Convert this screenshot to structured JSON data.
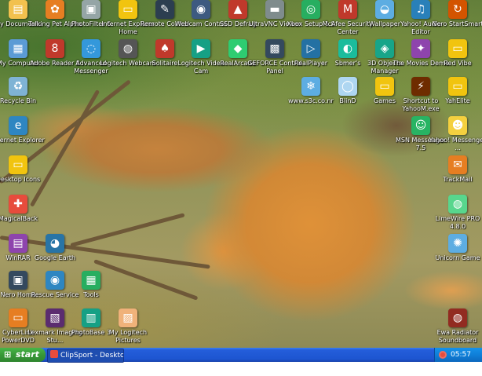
{
  "desktop": {
    "icons": [
      {
        "label": "My Documents",
        "icon": "folder-documents-icon",
        "color": "#f2c14e",
        "glyph": "▤"
      },
      {
        "label": "Talking Pet Alpha",
        "icon": "talking-pet-icon",
        "color": "#e67e22",
        "glyph": "✿"
      },
      {
        "label": "PhotoFilter 6",
        "icon": "photofilter-icon",
        "color": "#95a5a6",
        "glyph": "▣"
      },
      {
        "label": "Internet Explorer Home",
        "icon": "folder-icon",
        "color": "#f1c40f",
        "glyph": "▭"
      },
      {
        "label": "Remote Control",
        "icon": "remote-control-icon",
        "color": "#2c3e50",
        "glyph": "✎"
      },
      {
        "label": "Webcam Control",
        "icon": "webcam-icon",
        "color": "#3d5a80",
        "glyph": "◉"
      },
      {
        "label": "SSD Defrag",
        "icon": "defrag-icon",
        "color": "#c0392b",
        "glyph": "▲"
      },
      {
        "label": "UltraVNC Viewer",
        "icon": "vnc-viewer-icon",
        "color": "#7f8c8d",
        "glyph": "▬"
      },
      {
        "label": "Xbox Setup 1.0",
        "icon": "xbox-setup-icon",
        "color": "#27ae60",
        "glyph": "◎"
      },
      {
        "label": "McAfee Security Center",
        "icon": "mcafee-icon",
        "color": "#c0392b",
        "glyph": "M"
      },
      {
        "label": "Wallpaper",
        "icon": "wallpaper-icon",
        "color": "#5dade2",
        "glyph": "◒"
      },
      {
        "label": "Yahoo! Audio Editor",
        "icon": "audio-editor-icon",
        "color": "#2980b9",
        "glyph": "♫"
      },
      {
        "label": "Nero StartSmart",
        "icon": "nero-icon",
        "color": "#d35400",
        "glyph": "↻"
      },
      {
        "label": "My Computer",
        "icon": "my-computer-icon",
        "color": "#5b9bd5",
        "glyph": "▦"
      },
      {
        "label": "Adobe Reader 8",
        "icon": "adobe-reader-icon",
        "color": "#c0392b",
        "glyph": "8"
      },
      {
        "label": "Advanced Messenger",
        "icon": "messenger-icon",
        "color": "#3498db",
        "glyph": "◌"
      },
      {
        "label": "Logitech Webcam",
        "icon": "webcam-software-icon",
        "color": "#555555",
        "glyph": "◍"
      },
      {
        "label": "Solitaire",
        "icon": "solitaire-icon",
        "color": "#c0392b",
        "glyph": "♠"
      },
      {
        "label": "Logitech Video Cam",
        "icon": "video-cam-icon",
        "color": "#16a085",
        "glyph": "▶"
      },
      {
        "label": "RealArcade",
        "icon": "realarcade-icon",
        "color": "#2ecc71",
        "glyph": "◆"
      },
      {
        "label": "GEFORCE Control Panel",
        "icon": "control-panel-icon",
        "color": "#34495e",
        "glyph": "▩"
      },
      {
        "label": "RealPlayer",
        "icon": "realplayer-icon",
        "color": "#2471a3",
        "glyph": "▷"
      },
      {
        "label": "Sbmer's",
        "icon": "globe-icon",
        "color": "#1abc9c",
        "glyph": "◐"
      },
      {
        "label": "3D Objects Manager",
        "icon": "objects-manager-icon",
        "color": "#17a589",
        "glyph": "◈"
      },
      {
        "label": "The Movies Demo",
        "icon": "movies-demo-icon",
        "color": "#8e44ad",
        "glyph": "✦"
      },
      {
        "label": "Red Vibe",
        "icon": "folder-icon",
        "color": "#f1c40f",
        "glyph": "▭"
      },
      {
        "label": "Recycle Bin",
        "icon": "recycle-bin-icon",
        "color": "#7fb3d5",
        "glyph": "♻"
      },
      {
        "label": "www.s3c.co.nr",
        "icon": "snowflake-icon",
        "color": "#5dade2",
        "glyph": "❄"
      },
      {
        "label": "BlinD",
        "icon": "chat-bubble-icon",
        "color": "#aed6f1",
        "glyph": "◯"
      },
      {
        "label": "Games",
        "icon": "folder-icon",
        "color": "#f1c40f",
        "glyph": "▭"
      },
      {
        "label": "Shortcut to YahooM.exe",
        "icon": "shortcut-icon",
        "color": "#6e2c00",
        "glyph": "⚡"
      },
      {
        "label": "YahElite",
        "icon": "folder-icon",
        "color": "#f1c40f",
        "glyph": "▭"
      },
      {
        "label": "Internet Explorer",
        "icon": "internet-explorer-icon",
        "color": "#2e86c1",
        "glyph": "e"
      },
      {
        "label": "MSN Messenger 7.5",
        "icon": "msn-messenger-icon",
        "color": "#28b463",
        "glyph": "☺"
      },
      {
        "label": "Yahoo! Messenger ...",
        "icon": "yahoo-messenger-icon",
        "color": "#f4d03f",
        "glyph": "☻"
      },
      {
        "label": "Desktop Icons",
        "icon": "folder-icon",
        "color": "#f1c40f",
        "glyph": "▭"
      },
      {
        "label": "TrackMail",
        "icon": "mail-icon",
        "color": "#e67e22",
        "glyph": "✉"
      },
      {
        "label": "MagicalBack",
        "icon": "magical-back-icon",
        "color": "#e74c3c",
        "glyph": "✚"
      },
      {
        "label": "LimeWire PRO 4.8.0",
        "icon": "limewire-icon",
        "color": "#58d68d",
        "glyph": "◍"
      },
      {
        "label": "WinRAR",
        "icon": "winrar-icon",
        "color": "#8e44ad",
        "glyph": "▤"
      },
      {
        "label": "Google Earth",
        "icon": "google-earth-icon",
        "color": "#2874a6",
        "glyph": "◕"
      },
      {
        "label": "Unicorn Game",
        "icon": "unicorn-game-icon",
        "color": "#5dade2",
        "glyph": "✺"
      },
      {
        "label": "Nero Home",
        "icon": "nero-home-icon",
        "color": "#34495e",
        "glyph": "▣"
      },
      {
        "label": "Rescue Service",
        "icon": "rescue-icon",
        "color": "#2e86c1",
        "glyph": "◉"
      },
      {
        "label": "Tools",
        "icon": "tools-icon",
        "color": "#27ae60",
        "glyph": "▦"
      },
      {
        "label": "CyberLink PowerDVD",
        "icon": "powerdvd-icon",
        "color": "#e67e22",
        "glyph": "▭"
      },
      {
        "label": "Lexmark Imaging Stu...",
        "icon": "lexmark-icon",
        "color": "#5b2c6f",
        "glyph": "▧"
      },
      {
        "label": "PhotoBase 3",
        "icon": "photobase-icon",
        "color": "#16a085",
        "glyph": "▥"
      },
      {
        "label": "My Logitech Pictures",
        "icon": "logitech-pictures-icon",
        "color": "#f0b27a",
        "glyph": "▨"
      },
      {
        "label": "Ewa Radiator Soundboard",
        "icon": "soundboard-icon",
        "color": "#922b21",
        "glyph": "◍"
      }
    ]
  },
  "taskbar": {
    "start_label": "start",
    "start_flag": "⊞",
    "task_label": "ClipSport - Desktop B...",
    "clock": "05:57 AM"
  },
  "colors": {
    "taskbar_blue": "#245edb",
    "start_green": "#379837",
    "tray_blue": "#0f7fd8"
  }
}
